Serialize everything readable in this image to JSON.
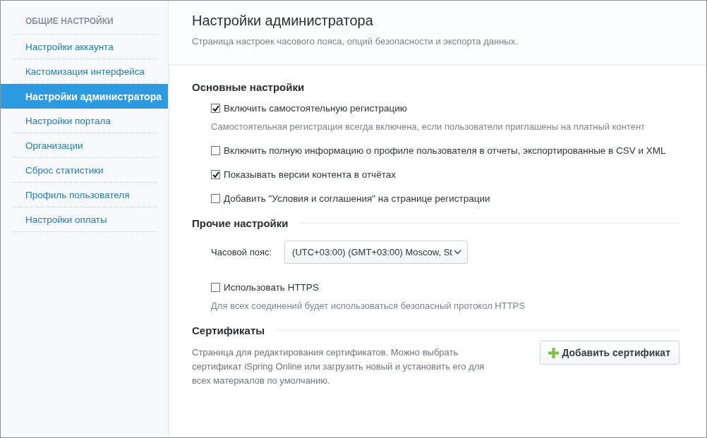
{
  "sidebar": {
    "heading": "ОБЩИЕ НАСТРОЙКИ",
    "items": [
      {
        "label": "Настройки аккаунта",
        "selected": false
      },
      {
        "label": "Кастомизация интерфейса",
        "selected": false
      },
      {
        "label": "Настройки администратора",
        "selected": true
      },
      {
        "label": "Настройки портала",
        "selected": false
      },
      {
        "label": "Организации",
        "selected": false
      },
      {
        "label": "Сброс статистики",
        "selected": false
      },
      {
        "label": "Профиль пользователя",
        "selected": false
      },
      {
        "label": "Настройки оплаты",
        "selected": false
      }
    ]
  },
  "header": {
    "title": "Настройки администратора",
    "subtitle": "Страница настроек часового пояса, опций безопасности и экспорта данных."
  },
  "main_settings": {
    "title": "Основные настройки",
    "options": [
      {
        "label": "Включить самостоятельную регистрацию",
        "checked": true,
        "hint": "Самостоятельная регистрация всегда включена, если пользователи приглашены на платный контент"
      },
      {
        "label": "Включить полную информацию о профиле пользователя в отчеты, экспортированные в CSV и XML",
        "checked": false
      },
      {
        "label": "Показывать версии контента в отчётах",
        "checked": true
      },
      {
        "label": "Добавить \"Условия и соглашения\" на странице регистрации",
        "checked": false
      }
    ]
  },
  "other_settings": {
    "title": "Прочие настройки",
    "timezone": {
      "label": "Часовой пояс:",
      "value": "(UTC+03:00) (GMT+03:00) Moscow, St"
    },
    "options": [
      {
        "label": "Использовать HTTPS",
        "checked": false,
        "hint": "Для всех соединений будет использоваться безопасный протокол HTTPS"
      }
    ]
  },
  "certificates": {
    "title": "Сертификаты",
    "description": "Страница для редактирования сертификатов. Можно выбрать сертификат iSpring Online или загрузить новый и установить его для всех материалов по умолчанию.",
    "button": "Добавить сертификат"
  }
}
